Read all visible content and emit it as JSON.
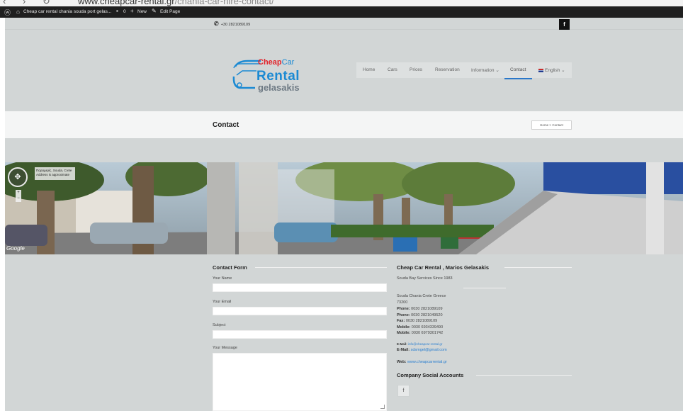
{
  "browser": {
    "url_host": "www.cheapcar-rental.gr",
    "url_path": "/chania-car-hire-contact/"
  },
  "admin_bar": {
    "site_label": "Cheap car rental chania souda port gelas...",
    "comments_count": "0",
    "new_label": "New",
    "edit_label": "Edit Page"
  },
  "topbar": {
    "phone": "+30 2821089109",
    "facebook_letter": "f"
  },
  "logo": {
    "line1_a": "Cheap",
    "line1_b": "Car",
    "line2": "Rental",
    "line3": "gelasakis"
  },
  "nav": {
    "items": [
      "Home",
      "Cars",
      "Prices",
      "Reservation",
      "Information ⌄",
      "Contact",
      "English ⌄"
    ]
  },
  "page": {
    "title": "Contact",
    "breadcrumb_home": "Home",
    "breadcrumb_sep": ">",
    "breadcrumb_current": "Contact"
  },
  "streetview": {
    "place": "Παραμερίς, Souda, Crete",
    "address": "Address is approximate",
    "google": "Google"
  },
  "contact_form": {
    "heading": "Contact Form",
    "name_label": "Your Name",
    "email_label": "Your Email",
    "subject_label": "Subject",
    "message_label": "Your Message"
  },
  "info": {
    "heading": "Cheap Car Rental , Marios Gelasakis",
    "tagline": "Souda Bay Services Since 1983",
    "address1": "Souda Chania Crete Greece",
    "postcode": "73200",
    "phone1_label": "Phone:",
    "phone1": "0030 2821089109",
    "phone2_label": "Phone:",
    "phone2": "0030 2821049520",
    "fax_label": "Fax:",
    "fax": "0030 2821089109",
    "mobile1_label": "Mobile:",
    "mobile1": "0030 6934339490",
    "mobile2_label": "Mobile:",
    "mobile2": "0030 6979301742",
    "email1_label": "E-Mail:",
    "email1": "info@cheapcar-rental.gr",
    "email2_label": "E-Mail:",
    "email2": "sdsmgel@gmail.com",
    "web_label": "Web:",
    "web": "www.cheapcarrental.gr",
    "social_heading": "Company Social Accounts",
    "social_fb": "f"
  }
}
